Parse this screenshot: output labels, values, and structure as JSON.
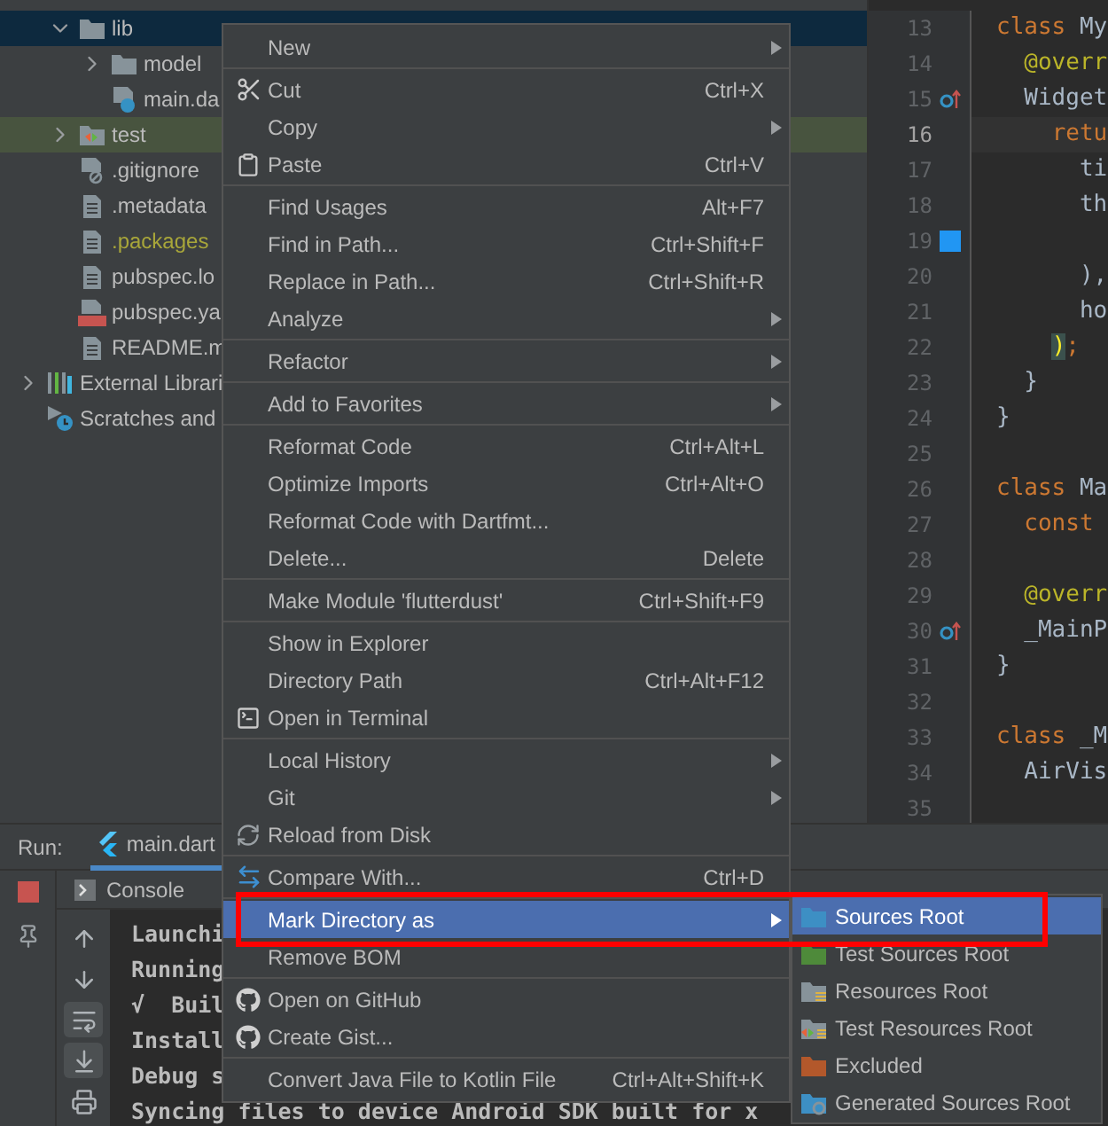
{
  "project_tree": [
    {
      "children": [
        {
          "kind": "folder",
          "label": "lib",
          "expanded": true,
          "selected": true,
          "highlighted": false,
          "ignored": false,
          "children": [
            {
              "kind": "folder",
              "label": "model",
              "expanded": false,
              "selected": false,
              "highlighted": false,
              "ignored": false
            },
            {
              "kind": "dart-file",
              "label": "main.da",
              "selected": false,
              "highlighted": false,
              "ignored": false
            }
          ]
        },
        {
          "kind": "test-folder",
          "label": "test",
          "expanded": false,
          "selected": false,
          "highlighted": true,
          "ignored": false
        },
        {
          "kind": "ignore-file",
          "label": ".gitignore",
          "selected": false,
          "highlighted": false,
          "ignored": false
        },
        {
          "kind": "text-file",
          "label": ".metadata",
          "selected": false,
          "highlighted": false,
          "ignored": false
        },
        {
          "kind": "text-file",
          "label": ".packages",
          "selected": false,
          "highlighted": false,
          "ignored": true
        },
        {
          "kind": "text-file",
          "label": "pubspec.lo",
          "selected": false,
          "highlighted": false,
          "ignored": false
        },
        {
          "kind": "yaml-file",
          "label": "pubspec.ya",
          "selected": false,
          "highlighted": false,
          "ignored": false
        },
        {
          "kind": "text-file",
          "label": "README.m",
          "selected": false,
          "highlighted": false,
          "ignored": false
        }
      ]
    },
    {
      "kind": "libraries",
      "label": "External Librari",
      "expanded": false,
      "selected": false,
      "highlighted": false,
      "ignored": false
    },
    {
      "kind": "scratches",
      "label": "Scratches and",
      "selected": false,
      "highlighted": false,
      "ignored": false
    }
  ],
  "editor": {
    "lines": [
      {
        "number": "13",
        "current": false,
        "tokens": [
          {
            "text": "class ",
            "kind": "keyword"
          },
          {
            "text": "My",
            "kind": "plain"
          }
        ]
      },
      {
        "number": "14",
        "current": false,
        "tokens": [
          {
            "text": "  @overr",
            "kind": "annotation"
          }
        ]
      },
      {
        "number": "15",
        "current": false,
        "kind": "override",
        "tokens": [
          {
            "text": "  Widget",
            "kind": "plain"
          }
        ]
      },
      {
        "number": "16",
        "current": true,
        "tokens": [
          {
            "text": "    retu",
            "kind": "keyword"
          }
        ]
      },
      {
        "number": "17",
        "current": false,
        "tokens": [
          {
            "text": "      ti",
            "kind": "plain"
          }
        ]
      },
      {
        "number": "18",
        "current": false,
        "tokens": [
          {
            "text": "      th",
            "kind": "plain"
          }
        ]
      },
      {
        "number": "19",
        "current": false,
        "kind": "swatch",
        "color": "#2196f3"
      },
      {
        "number": "20",
        "current": false,
        "tokens": [
          {
            "text": "      ),",
            "kind": "plain"
          }
        ]
      },
      {
        "number": "21",
        "current": false,
        "tokens": [
          {
            "text": "      ho",
            "kind": "plain"
          }
        ]
      },
      {
        "number": "22",
        "current": false,
        "tokens": [
          {
            "text": "    )",
            "kind": "matched"
          },
          {
            "text": ";",
            "kind": "keyword"
          }
        ]
      },
      {
        "number": "23",
        "current": false,
        "tokens": [
          {
            "text": "  }",
            "kind": "plain"
          }
        ]
      },
      {
        "number": "24",
        "current": false,
        "tokens": [
          {
            "text": "}",
            "kind": "plain"
          }
        ]
      },
      {
        "number": "25",
        "current": false
      },
      {
        "number": "26",
        "current": false,
        "tokens": [
          {
            "text": "class ",
            "kind": "keyword"
          },
          {
            "text": "Ma",
            "kind": "plain"
          }
        ]
      },
      {
        "number": "27",
        "current": false,
        "tokens": [
          {
            "text": "  const",
            "kind": "keyword"
          }
        ]
      },
      {
        "number": "28",
        "current": false
      },
      {
        "number": "29",
        "current": false,
        "tokens": [
          {
            "text": "  @overr",
            "kind": "annotation"
          }
        ]
      },
      {
        "number": "30",
        "current": false,
        "kind": "override",
        "tokens": [
          {
            "text": "  _MainP",
            "kind": "plain"
          }
        ]
      },
      {
        "number": "31",
        "current": false,
        "tokens": [
          {
            "text": "}",
            "kind": "plain"
          }
        ]
      },
      {
        "number": "32",
        "current": false
      },
      {
        "number": "33",
        "current": false,
        "tokens": [
          {
            "text": "class ",
            "kind": "keyword"
          },
          {
            "text": "_M",
            "kind": "plain"
          }
        ]
      },
      {
        "number": "34",
        "current": false,
        "tokens": [
          {
            "text": "  AirVis",
            "kind": "plain"
          }
        ]
      },
      {
        "number": "35",
        "current": false
      }
    ]
  },
  "run_panel": {
    "label": "Run:",
    "tabs": [
      {
        "label": "main.dart",
        "selected": true
      }
    ],
    "console_tab": "Console",
    "toolbar": [
      {
        "kind": "up",
        "on": false
      },
      {
        "kind": "down",
        "on": false
      },
      {
        "kind": "wrap",
        "on": true
      },
      {
        "kind": "scroll-end",
        "on": true
      },
      {
        "kind": "print",
        "on": false
      }
    ],
    "lines": [
      "Launchi",
      "Running",
      "√  Buil",
      "Install",
      "Debug s",
      "Syncing files to device Android SDK built for x"
    ]
  },
  "context_menu": {
    "items": [
      {
        "kind": "item",
        "label": "New",
        "submenu": true,
        "selected": false
      },
      {
        "kind": "separator"
      },
      {
        "kind": "cut",
        "label": "Cut",
        "shortcut": "Ctrl+X",
        "selected": false
      },
      {
        "kind": "item",
        "label": "Copy",
        "submenu": true,
        "selected": false
      },
      {
        "kind": "paste",
        "label": "Paste",
        "shortcut": "Ctrl+V",
        "selected": false
      },
      {
        "kind": "separator"
      },
      {
        "kind": "item",
        "label": "Find Usages",
        "shortcut": "Alt+F7",
        "selected": false
      },
      {
        "kind": "item",
        "label": "Find in Path...",
        "shortcut": "Ctrl+Shift+F",
        "selected": false
      },
      {
        "kind": "item",
        "label": "Replace in Path...",
        "shortcut": "Ctrl+Shift+R",
        "selected": false
      },
      {
        "kind": "item",
        "label": "Analyze",
        "submenu": true,
        "selected": false
      },
      {
        "kind": "separator"
      },
      {
        "kind": "item",
        "label": "Refactor",
        "submenu": true,
        "selected": false
      },
      {
        "kind": "separator"
      },
      {
        "kind": "item",
        "label": "Add to Favorites",
        "submenu": true,
        "selected": false
      },
      {
        "kind": "separator"
      },
      {
        "kind": "item",
        "label": "Reformat Code",
        "shortcut": "Ctrl+Alt+L",
        "selected": false
      },
      {
        "kind": "item",
        "label": "Optimize Imports",
        "shortcut": "Ctrl+Alt+O",
        "selected": false
      },
      {
        "kind": "item",
        "label": "Reformat Code with Dartfmt...",
        "selected": false
      },
      {
        "kind": "item",
        "label": "Delete...",
        "shortcut": "Delete",
        "selected": false
      },
      {
        "kind": "separator"
      },
      {
        "kind": "item",
        "label": "Make Module 'flutterdust'",
        "shortcut": "Ctrl+Shift+F9",
        "selected": false
      },
      {
        "kind": "separator"
      },
      {
        "kind": "item",
        "label": "Show in Explorer",
        "selected": false
      },
      {
        "kind": "item",
        "label": "Directory Path",
        "shortcut": "Ctrl+Alt+F12",
        "selected": false
      },
      {
        "kind": "terminal",
        "label": "Open in Terminal",
        "selected": false
      },
      {
        "kind": "separator"
      },
      {
        "kind": "item",
        "label": "Local History",
        "submenu": true,
        "selected": false
      },
      {
        "kind": "item",
        "label": "Git",
        "submenu": true,
        "selected": false
      },
      {
        "kind": "reload",
        "label": "Reload from Disk",
        "selected": false
      },
      {
        "kind": "separator"
      },
      {
        "kind": "compare",
        "label": "Compare With...",
        "shortcut": "Ctrl+D",
        "selected": false
      },
      {
        "kind": "separator"
      },
      {
        "kind": "item",
        "label": "Mark Directory as",
        "submenu": true,
        "selected": true
      },
      {
        "kind": "item",
        "label": "Remove BOM",
        "selected": false
      },
      {
        "kind": "separator"
      },
      {
        "kind": "github",
        "label": "Open on GitHub",
        "selected": false
      },
      {
        "kind": "github",
        "label": "Create Gist...",
        "selected": false
      },
      {
        "kind": "separator"
      },
      {
        "kind": "item",
        "label": "Convert Java File to Kotlin File",
        "shortcut": "Ctrl+Alt+Shift+K",
        "selected": false
      }
    ]
  },
  "submenu": {
    "items": [
      {
        "kind": "sources",
        "label": "Sources Root",
        "selected": true
      },
      {
        "kind": "test-sources",
        "label": "Test Sources Root",
        "selected": false
      },
      {
        "kind": "resources",
        "label": "Resources Root",
        "selected": false
      },
      {
        "kind": "test-resources",
        "label": "Test Resources Root",
        "selected": false
      },
      {
        "kind": "excluded",
        "label": "Excluded",
        "selected": false
      },
      {
        "kind": "generated",
        "label": "Generated Sources Root",
        "selected": false
      }
    ]
  }
}
